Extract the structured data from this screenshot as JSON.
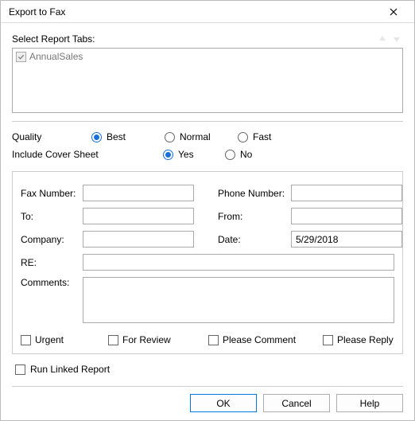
{
  "window": {
    "title": "Export to Fax"
  },
  "reportTabs": {
    "label": "Select Report Tabs:",
    "items": [
      "AnnualSales"
    ]
  },
  "quality": {
    "label": "Quality",
    "options": {
      "best": "Best",
      "normal": "Normal",
      "fast": "Fast"
    },
    "selected": "best"
  },
  "coverSheet": {
    "label": "Include Cover Sheet",
    "options": {
      "yes": "Yes",
      "no": "No"
    },
    "selected": "yes"
  },
  "fields": {
    "faxNumber": {
      "label": "Fax Number:",
      "value": ""
    },
    "phoneNumber": {
      "label": "Phone Number:",
      "value": ""
    },
    "to": {
      "label": "To:",
      "value": ""
    },
    "from": {
      "label": "From:",
      "value": ""
    },
    "company": {
      "label": "Company:",
      "value": ""
    },
    "date": {
      "label": "Date:",
      "value": "5/29/2018"
    },
    "re": {
      "label": "RE:",
      "value": ""
    },
    "comments": {
      "label": "Comments:",
      "value": ""
    }
  },
  "flags": {
    "urgent": "Urgent",
    "forReview": "For Review",
    "pleaseComment": "Please Comment",
    "pleaseReply": "Please Reply"
  },
  "runLinked": {
    "label": "Run Linked Report"
  },
  "buttons": {
    "ok": "OK",
    "cancel": "Cancel",
    "help": "Help"
  }
}
